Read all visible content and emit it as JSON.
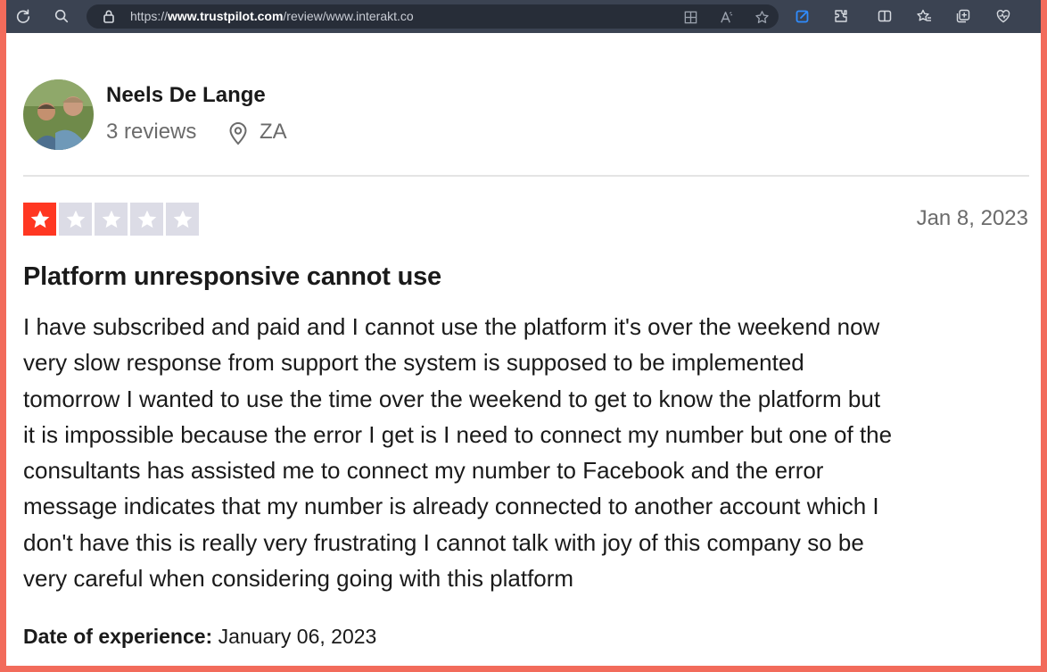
{
  "browser": {
    "url_prefix": "https://",
    "url_host": "www.trustpilot.com",
    "url_path": "/review/www.interakt.co",
    "toolbar_icons": [
      "refresh-icon",
      "search-icon",
      "lock-icon",
      "split-view-icon",
      "read-aloud-icon",
      "favorite-icon",
      "active-extension-icon",
      "extensions-icon",
      "split-screen-icon",
      "favorites-icon",
      "collections-icon",
      "health-icon"
    ]
  },
  "reviewer": {
    "name": "Neels De Lange",
    "reviews": "3 reviews",
    "country": "ZA"
  },
  "review": {
    "rating": 1,
    "max_rating": 5,
    "rating_color": "#ff3722",
    "empty_star_color": "#dcdce6",
    "date": "Jan 8, 2023",
    "title": "Platform unresponsive cannot use",
    "body_lines": [
      "I have subscribed and paid and I cannot use the platform it's over the weekend now",
      "very slow response from support the system is supposed to be implemented",
      "tomorrow I wanted to use the time over the weekend to get to know the platform but",
      "it is impossible because the error I get is I need to connect my number but one of the",
      "consultants has assisted me to connect my number to Facebook and the error",
      "message indicates that my number is already connected to another account which I",
      "don't have this is really very frustrating I cannot talk with joy of this company so be",
      "very careful when considering going with this platform"
    ],
    "experience_label": "Date of experience:",
    "experience_date": "January 06, 2023"
  }
}
